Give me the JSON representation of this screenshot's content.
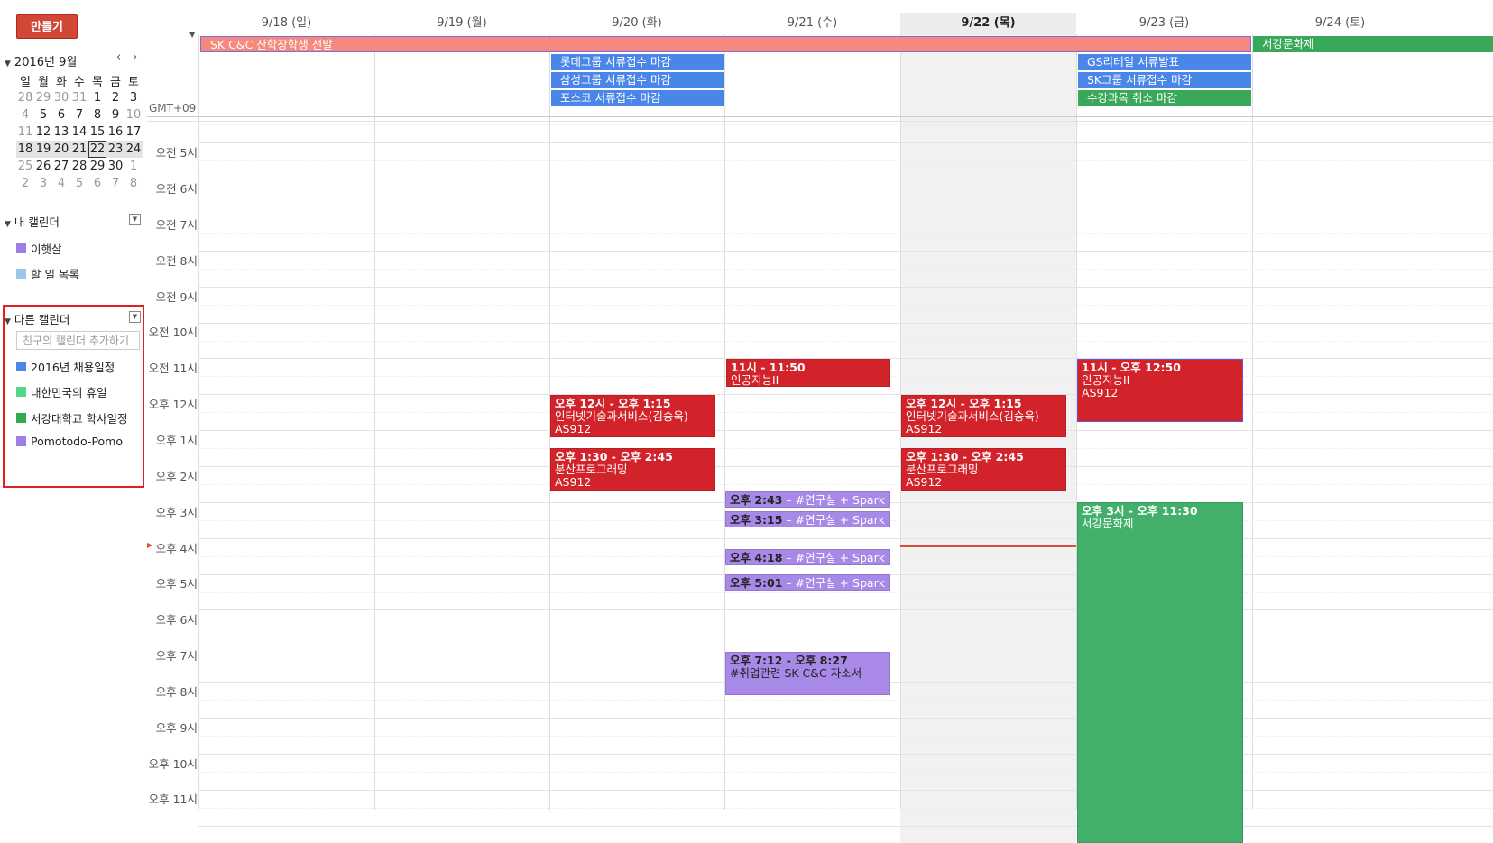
{
  "sidebar": {
    "create_label": "만들기",
    "mini_cal": {
      "title": "2016년 9월",
      "prev": "‹",
      "next": "›",
      "weekdays": [
        "일",
        "월",
        "화",
        "수",
        "목",
        "금",
        "토"
      ],
      "weeks": [
        [
          "28",
          "29",
          "30",
          "31",
          "1",
          "2",
          "3"
        ],
        [
          "4",
          "5",
          "6",
          "7",
          "8",
          "9",
          "10"
        ],
        [
          "11",
          "12",
          "13",
          "14",
          "15",
          "16",
          "17"
        ],
        [
          "18",
          "19",
          "20",
          "21",
          "22",
          "23",
          "24"
        ],
        [
          "25",
          "26",
          "27",
          "28",
          "29",
          "30",
          "1"
        ],
        [
          "2",
          "3",
          "4",
          "5",
          "6",
          "7",
          "8"
        ]
      ]
    },
    "my_calendars": {
      "title": "내 캘린더",
      "items": [
        {
          "label": "이햇살",
          "color": "#a07ee8"
        },
        {
          "label": "할 일 목록",
          "color": "#9fc6e7"
        }
      ]
    },
    "other_calendars": {
      "title": "다른 캘린더",
      "placeholder": "친구의 캘린더 추가하기",
      "items": [
        {
          "label": "2016년 채용일정",
          "color": "#4a86e8"
        },
        {
          "label": "대한민국의 휴일",
          "color": "#51d88a"
        },
        {
          "label": "서강대학교 학사일정",
          "color": "#33a853"
        },
        {
          "label": "Pomotodo-Pomo",
          "color": "#a07ee8"
        }
      ]
    }
  },
  "days": [
    "9/18 (일)",
    "9/19 (월)",
    "9/20 (화)",
    "9/21 (수)",
    "9/22 (목)",
    "9/23 (금)",
    "9/24 (토)"
  ],
  "timezone": "GMT+09",
  "hours": [
    "오전 5시",
    "오전 6시",
    "오전 7시",
    "오전 8시",
    "오전 9시",
    "오전 10시",
    "오전 11시",
    "오후 12시",
    "오후 1시",
    "오후 2시",
    "오후 3시",
    "오후 4시",
    "오후 5시",
    "오후 6시",
    "오후 7시",
    "오후 8시",
    "오후 9시",
    "오후 10시",
    "오후 11시"
  ],
  "all_day": {
    "sk_banner": "SK C&C 산학장학생 선발",
    "sogang_festival": "서강문화제",
    "tue": [
      "롯데그룹 서류접수 마감",
      "삼성그룹 서류접수 마감",
      "포스코 서류접수 마감"
    ],
    "fri": [
      "GS리테일 서류발표",
      "SK그룹 서류접수 마감",
      "수강과목 취소 마감"
    ]
  },
  "events": {
    "wed_ai": {
      "time": "11시 - 11:50",
      "title": "인공지능II"
    },
    "fri_ai": {
      "time": "11시 - 오후 12:50",
      "title": "인공지능II",
      "loc": "AS912"
    },
    "tue_net": {
      "time": "오후 12시 - 오후 1:15",
      "title": "인터넷기술과서비스(김승욱)",
      "loc": "AS912"
    },
    "thu_net": {
      "time": "오후 12시 - 오후 1:15",
      "title": "인터넷기술과서비스(김승욱)",
      "loc": "AS912"
    },
    "tue_dp": {
      "time": "오후 1:30 - 오후 2:45",
      "title": "분산프로그래밍",
      "loc": "AS912"
    },
    "thu_dp": {
      "time": "오후 1:30 - 오후 2:45",
      "title": "분산프로그래밍",
      "loc": "AS912"
    },
    "pomo1": {
      "time": "오후 2:43",
      "title": " – #연구실 + Spark"
    },
    "pomo2": {
      "time": "오후 3:15",
      "title": " – #연구실 + Spark"
    },
    "pomo3": {
      "time": "오후 4:18",
      "title": " – #연구실 + Spark"
    },
    "pomo4": {
      "time": "오후 5:01",
      "title": " – #연구실 + Spark"
    },
    "pomo5": {
      "time": "오후 7:12 - 오후 8:27",
      "title": "#취업관련 SK C&C 자소서"
    },
    "festival": {
      "time": "오후 3시 - 오후 11:30",
      "title": "서강문화제"
    }
  },
  "colors": {
    "create": "#d14836",
    "recruit": "#4a86e8",
    "class": "#d2232a",
    "pomo": "#a889e8",
    "sogang": "#3aa85a",
    "festival": "#42b06a",
    "sk_banner": "#f58a7c",
    "now": "#dd4b39"
  }
}
